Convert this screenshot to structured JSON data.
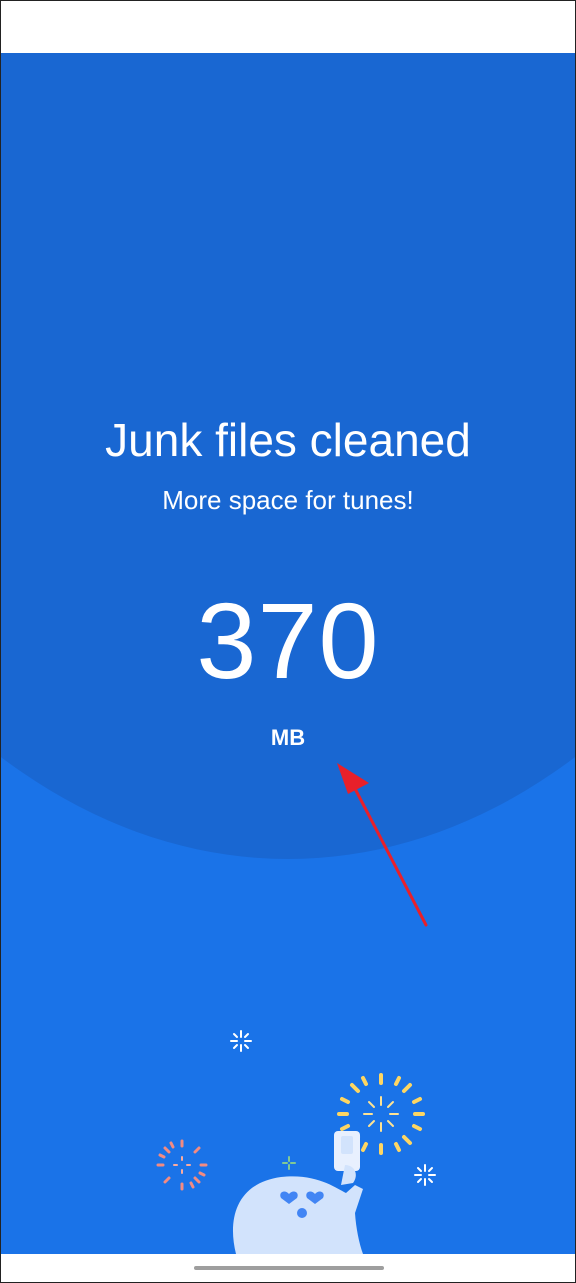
{
  "result": {
    "title": "Junk files cleaned",
    "subtitle": "More space for tunes!",
    "amount": "370",
    "unit": "MB"
  },
  "colors": {
    "background": "#1a73e8",
    "dark_arc": "#1967d2",
    "text": "#ffffff",
    "annotation_arrow": "#e8202a",
    "confetti_yellow": "#fdd663",
    "confetti_red": "#f28b82",
    "confetti_green": "#81c995",
    "mascot": "#d2e3fc"
  },
  "icons": {
    "annotation": "red-arrow-icon",
    "illustration": "celebrating-mascot-with-fireworks"
  }
}
